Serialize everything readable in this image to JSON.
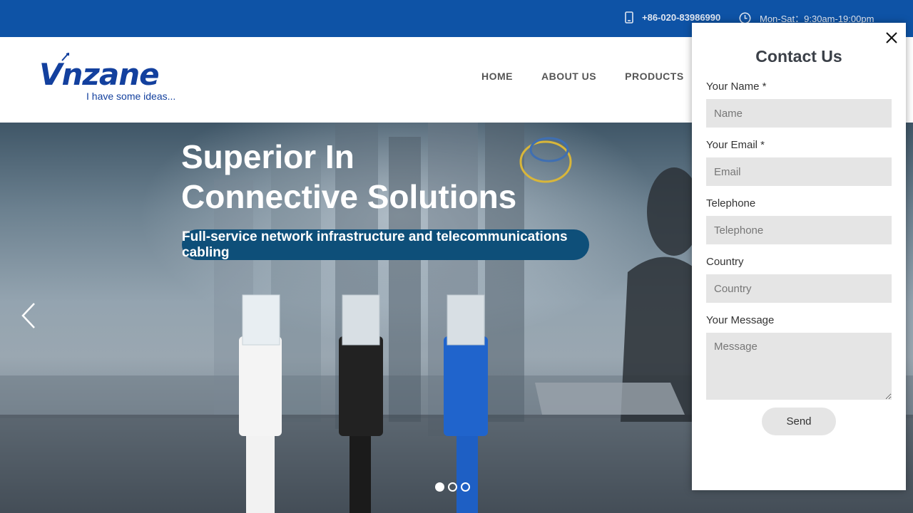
{
  "topbar": {
    "phone": "+86-020-83986990",
    "hours": "Mon-Sat：9:30am-19:00pm"
  },
  "header": {
    "logo_brand": "Vnzane",
    "logo_tagline": "I have some ideas...",
    "nav": [
      "HOME",
      "ABOUT US",
      "PRODUCTS"
    ]
  },
  "hero": {
    "title_line1": "Superior In",
    "title_line2": "Connective Solutions",
    "subtitle": "Full-service network infrastructure and telecommunications cabling",
    "slide_count": 3,
    "active_slide": 1
  },
  "contact_form": {
    "title": "Contact Us",
    "name_label": "Your Name *",
    "name_placeholder": "Name",
    "email_label": "Your Email *",
    "email_placeholder": "Email",
    "telephone_label": "Telephone",
    "telephone_placeholder": "Telephone",
    "country_label": "Country",
    "country_placeholder": "Country",
    "message_label": "Your Message",
    "message_placeholder": "Message",
    "send_label": "Send"
  },
  "colors": {
    "topbar": "#0e53a6",
    "brand": "#13409e",
    "pill": "#0e4f79",
    "field": "#e5e5e5"
  },
  "icons": [
    "phone-icon",
    "clock-icon",
    "close-icon",
    "chevron-left-icon"
  ]
}
